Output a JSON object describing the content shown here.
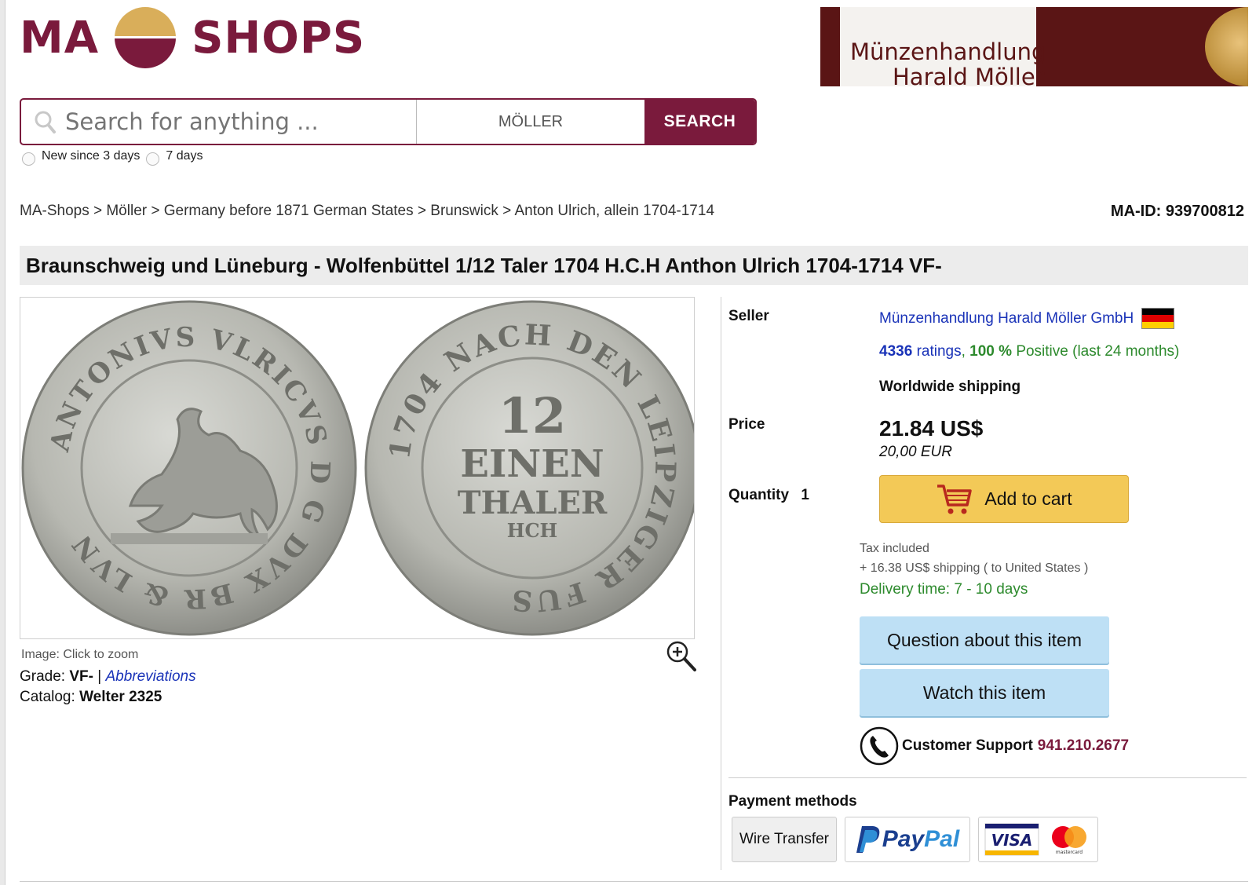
{
  "logo": {
    "left": "MA",
    "right": "SHOPS"
  },
  "banner": {
    "line1": "Münzenhandlung",
    "line2": "Harald Möller"
  },
  "search": {
    "placeholder": "Search for anything ...",
    "scope": "MÖLLER",
    "button": "SEARCH"
  },
  "filters": {
    "option1": "New since 3 days",
    "option2": "7 days"
  },
  "breadcrumb": {
    "text": "MA-Shops > Möller > Germany before 1871 German States > Brunswick > Anton Ulrich, allein 1704-1714"
  },
  "ma_id": "MA-ID: 939700812",
  "title": "Braunschweig und Lüneburg - Wolfenbüttel 1/12 Taler 1704 H.C.H Anthon Ulrich 1704-1714 VF-",
  "image": {
    "caption": "Image: Click to zoom",
    "obverse_legend": "ANTONIVS VLRICVS D G DVX BR & LVN",
    "reverse_legend": "1704 NACH DEN LEIPZIGER FUS",
    "reverse_center": [
      "12",
      "EINEN",
      "THALER",
      "HCH"
    ]
  },
  "grade": {
    "label": "Grade:",
    "value": "VF-",
    "sep": "|",
    "link": "Abbreviations"
  },
  "catalog": {
    "label": "Catalog:",
    "value": "Welter 2325"
  },
  "seller": {
    "label": "Seller",
    "name": "Münzenhandlung Harald Möller GmbH",
    "ratings_count": "4336",
    "ratings_word": "ratings",
    "positive_pct": "100 %",
    "positive_text": "Positive (last 24 months)",
    "shipping": "Worldwide shipping"
  },
  "price": {
    "label": "Price",
    "usd": "21.84 US$",
    "eur": "20,00 EUR"
  },
  "quantity": {
    "label": "Quantity",
    "value": "1"
  },
  "cart": {
    "label": "Add to cart"
  },
  "tax": "Tax included",
  "shipping_cost": "+ 16.38 US$ shipping ( to United States )",
  "delivery": "Delivery time: 7 - 10 days",
  "buttons": {
    "question": "Question about this item",
    "watch": "Watch this item"
  },
  "support": {
    "label": "Customer Support",
    "phone": "941.210.2677"
  },
  "payment": {
    "label": "Payment methods",
    "wire": "Wire Transfer",
    "paypal_p": "Pay",
    "paypal_q": "Pal",
    "visa": "VISA",
    "mastercard": "mastercard"
  },
  "colors": {
    "brand": "#7a1a3c",
    "gold": "#d9ae5a",
    "link": "#1a33b8",
    "positive": "#2d8a2d",
    "cart": "#f3c957",
    "button": "#bee0f5"
  }
}
